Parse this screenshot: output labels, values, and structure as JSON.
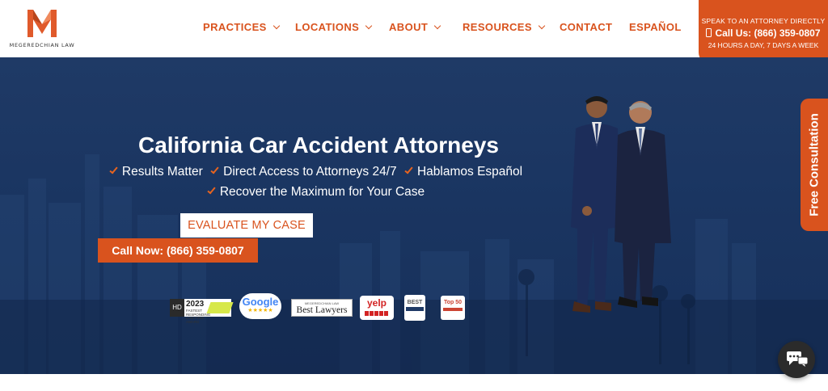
{
  "brand": {
    "logo_text": "MEGEREDCHIAN LAW",
    "primary_color": "#d9531e",
    "hero_color": "#1f3a66"
  },
  "nav": {
    "items": [
      {
        "label": "PRACTICES",
        "dropdown": true
      },
      {
        "label": "LOCATIONS",
        "dropdown": true
      },
      {
        "label": "ABOUT",
        "dropdown": true
      },
      {
        "label": "RESOURCES",
        "dropdown": true
      },
      {
        "label": "CONTACT",
        "dropdown": false
      },
      {
        "label": "ESPAÑOL",
        "dropdown": false
      }
    ]
  },
  "header_cta": {
    "line1": "SPEAK TO AN ATTORNEY DIRECTLY",
    "line2": "Call Us: (866) 359-0807",
    "line3": "24 HOURS A DAY, 7 DAYS A WEEK",
    "icon": "mobile-phone-icon"
  },
  "hero": {
    "title": "California Car Accident Attorneys",
    "checks_row1": [
      "Results Matter",
      "Direct Access to Attorneys 24/7",
      "Hablamos Español"
    ],
    "checks_row2": [
      "Recover the Maximum for Your Case"
    ],
    "evaluate_label": "EVALUATE MY CASE",
    "call_label": "Call Now: (866) 359-0807"
  },
  "badges": {
    "hd_year": "2023",
    "hd_text": "FASTEST RESPONDING LAW FIRM AWARD",
    "google": "Google",
    "google_stars": "★★★★★",
    "best_lawyers": "Best Lawyers",
    "best_lawyers_top": "MEGEREDCHIAN LAW",
    "yelp": "yelp",
    "best_label": "BEST",
    "top50_label": "Top 50"
  },
  "side_tab": {
    "label": "Free Consultation"
  },
  "chat": {
    "icon": "chat-bubbles-icon"
  }
}
